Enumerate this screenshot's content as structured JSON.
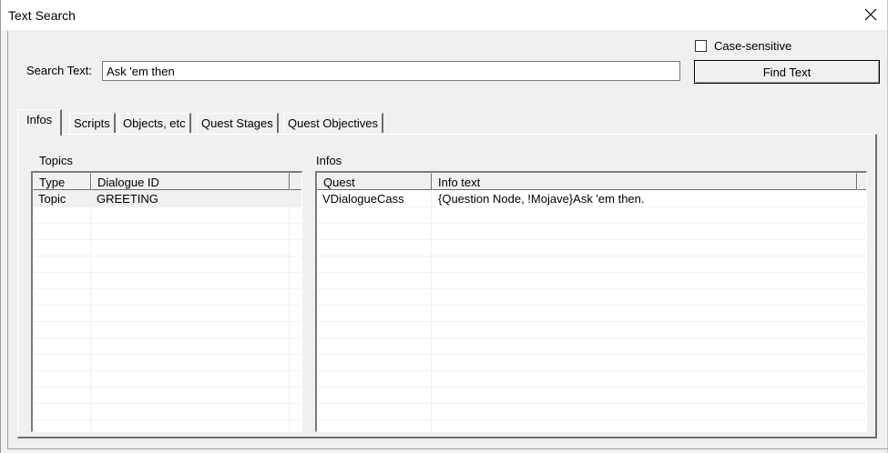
{
  "window": {
    "title": "Text Search"
  },
  "search": {
    "label": "Search Text:",
    "value": "Ask 'em then",
    "case_sensitive_label": "Case-sensitive",
    "case_sensitive_checked": false,
    "find_button_label": "Find Text"
  },
  "tabs": [
    {
      "label": "Infos",
      "active": true
    },
    {
      "label": "Scripts",
      "active": false
    },
    {
      "label": "Objects, etc",
      "active": false
    },
    {
      "label": "Quest Stages",
      "active": false
    },
    {
      "label": "Quest Objectives",
      "active": false
    }
  ],
  "topics": {
    "group_label": "Topics",
    "columns": [
      "Type",
      "Dialogue ID"
    ],
    "rows": [
      {
        "type": "Topic",
        "dialogue_id": "GREETING"
      }
    ]
  },
  "infos": {
    "group_label": "Infos",
    "columns": [
      "Quest",
      "Info text"
    ],
    "rows": [
      {
        "quest": "VDialogueCass",
        "info_text": "{Question Node, !Mojave}Ask 'em then."
      }
    ]
  },
  "icons": {
    "close": "close-icon"
  }
}
